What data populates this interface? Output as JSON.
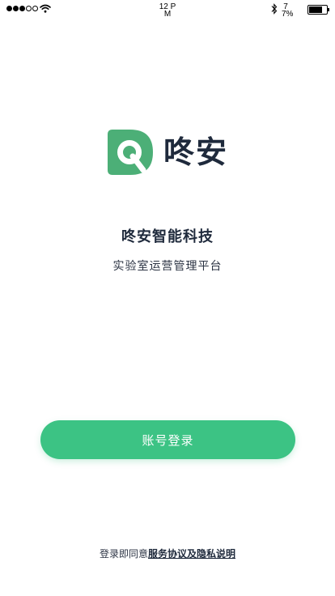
{
  "status_bar": {
    "time": "12 PM",
    "battery_percent": "77%",
    "signal": "2 of 5 dots filled"
  },
  "logo": {
    "text": "咚安",
    "brand_color": "#4caf77"
  },
  "company_name": "咚安智能科技",
  "tagline": "实验室运营管理平台",
  "login_button": {
    "label": "账号登录",
    "color": "#3cc384"
  },
  "agreement": {
    "prefix": "登录即同意",
    "link": "服务协议及隐私说明"
  }
}
